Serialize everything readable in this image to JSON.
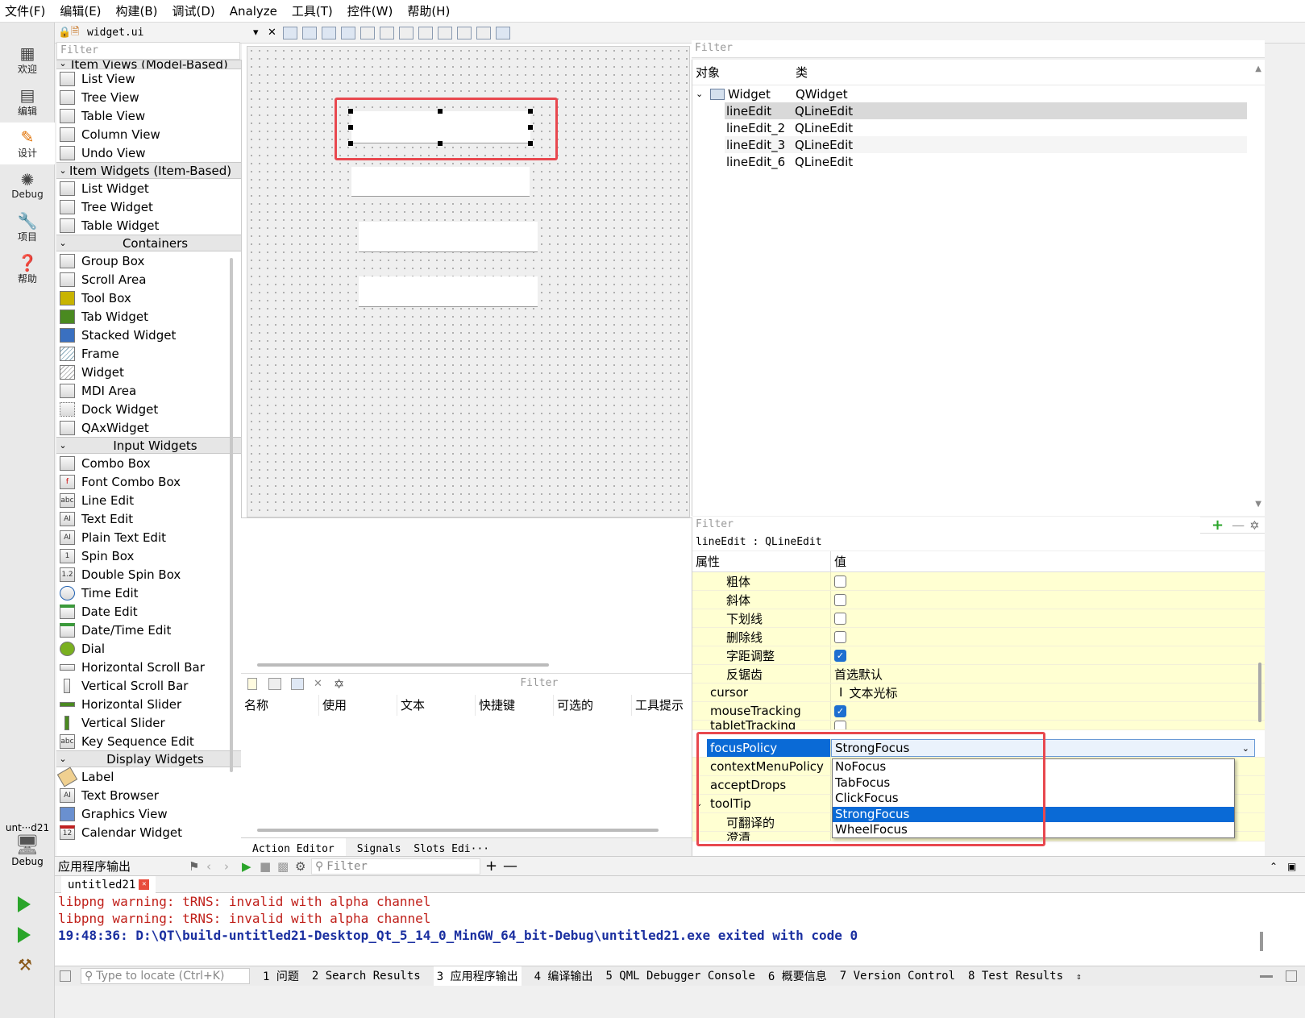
{
  "menu": [
    "文件(F)",
    "编辑(E)",
    "构建(B)",
    "调试(D)",
    "Analyze",
    "工具(T)",
    "控件(W)",
    "帮助(H)"
  ],
  "modes": [
    {
      "label": "欢迎",
      "icon": "grid-icon"
    },
    {
      "label": "编辑",
      "icon": "document-icon"
    },
    {
      "label": "设计",
      "icon": "pencil-icon"
    },
    {
      "label": "Debug",
      "icon": "bug-icon"
    },
    {
      "label": "项目",
      "icon": "wrench-icon"
    },
    {
      "label": "帮助",
      "icon": "help-icon"
    }
  ],
  "target": {
    "label": "unt···d21",
    "mode": "Debug"
  },
  "editor_file": "widget.ui",
  "filter_placeholder": "Filter",
  "widgetbox": {
    "partial_header": "Item Views (Model-Based)",
    "item_views": [
      "List View",
      "Tree View",
      "Table View",
      "Column View",
      "Undo View"
    ],
    "cat_item_widgets": "Item Widgets (Item-Based)",
    "item_widgets": [
      "List Widget",
      "Tree Widget",
      "Table Widget"
    ],
    "cat_containers": "Containers",
    "containers": [
      "Group Box",
      "Scroll Area",
      "Tool Box",
      "Tab Widget",
      "Stacked Widget",
      "Frame",
      "Widget",
      "MDI Area",
      "Dock Widget",
      "QAxWidget"
    ],
    "cat_input": "Input Widgets",
    "input": [
      "Combo Box",
      "Font Combo Box",
      "Line Edit",
      "Text Edit",
      "Plain Text Edit",
      "Spin Box",
      "Double Spin Box",
      "Time Edit",
      "Date Edit",
      "Date/Time Edit",
      "Dial",
      "Horizontal Scroll Bar",
      "Vertical Scroll Bar",
      "Horizontal Slider",
      "Vertical Slider",
      "Key Sequence Edit"
    ],
    "cat_display": "Display Widgets",
    "display": [
      "Label",
      "Text Browser",
      "Graphics View",
      "Calendar Widget"
    ]
  },
  "action_editor": {
    "columns": [
      "名称",
      "使用",
      "文本",
      "快捷键",
      "可选的",
      "工具提示"
    ],
    "tabs": [
      "Action Editor",
      "Signals  Slots Edi···"
    ]
  },
  "object_inspector": {
    "col_object": "对象",
    "col_class": "类",
    "rows": [
      {
        "name": "Widget",
        "cls": "QWidget"
      },
      {
        "name": "lineEdit",
        "cls": "QLineEdit"
      },
      {
        "name": "lineEdit_2",
        "cls": "QLineEdit"
      },
      {
        "name": "lineEdit_3",
        "cls": "QLineEdit"
      },
      {
        "name": "lineEdit_6",
        "cls": "QLineEdit"
      }
    ]
  },
  "property_editor": {
    "context": "lineEdit : QLineEdit",
    "col_prop": "属性",
    "col_value": "值",
    "rows": [
      {
        "name": "粗体",
        "value": "",
        "check": false
      },
      {
        "name": "斜体",
        "value": "",
        "check": false
      },
      {
        "name": "下划线",
        "value": "",
        "check": false
      },
      {
        "name": "删除线",
        "value": "",
        "check": false
      },
      {
        "name": "字距调整",
        "value": "",
        "check": true
      },
      {
        "name": "反锯齿",
        "value": "首选默认"
      },
      {
        "name": "cursor",
        "value": "文本光标"
      },
      {
        "name": "mouseTracking",
        "value": "",
        "check": true
      },
      {
        "name": "tabletTracking",
        "value": "",
        "check": false
      },
      {
        "name": "focusPolicy",
        "value": "StrongFocus"
      },
      {
        "name": "contextMenuPolicy",
        "value": ""
      },
      {
        "name": "acceptDrops",
        "value": ""
      },
      {
        "name": "toolTip",
        "value": ""
      },
      {
        "name": "可翻译的",
        "value": ""
      },
      {
        "name": "澄清",
        "value": ""
      }
    ],
    "focus_options": [
      "NoFocus",
      "TabFocus",
      "ClickFocus",
      "StrongFocus",
      "WheelFocus"
    ],
    "focus_selected": "StrongFocus"
  },
  "output": {
    "title": "应用程序输出",
    "filter": "Filter",
    "tab": "untitled21",
    "lines": [
      {
        "text": "libpng warning: tRNS: invalid with alpha channel",
        "color": "#c0201a"
      },
      {
        "text": "libpng warning: tRNS: invalid with alpha channel",
        "color": "#c0201a"
      },
      {
        "text": "19:48:36: D:\\QT\\build-untitled21-Desktop_Qt_5_14_0_MinGW_64_bit-Debug\\untitled21.exe exited with code 0",
        "color": "#1a2fa0"
      }
    ]
  },
  "statusbar": {
    "locate_placeholder": "Type to locate (Ctrl+K)",
    "tabs": [
      "1 问题",
      "2 Search Results",
      "3 应用程序输出",
      "4 编译输出",
      "5 QML Debugger Console",
      "6 概要信息",
      "7 Version Control",
      "8 Test Results"
    ]
  },
  "colors": {
    "accent": "#0a6ad6",
    "highlight_box": "#e8484f",
    "property_bg": "#ffffd2"
  }
}
